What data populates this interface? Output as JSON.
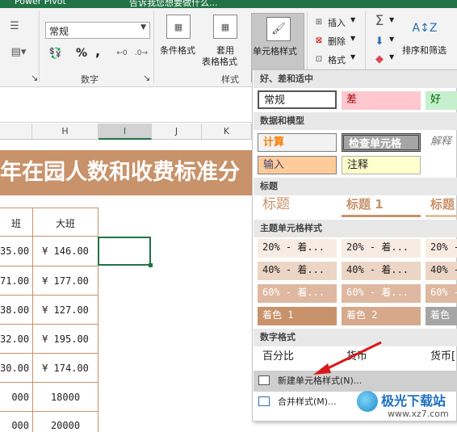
{
  "title_bar": {
    "left_text": "Power Pivot",
    "doc_text": "告诉我您想要做什么..."
  },
  "ribbon": {
    "number_format": "常规",
    "percent_symbol": "%",
    "comma_symbol": ",",
    "group_number_label": "数字",
    "cond_format_label": "条件格式",
    "table_format_label1": "套用",
    "table_format_label2": "表格格式",
    "cell_style_label": "单元格样式",
    "group_style_label": "样式",
    "insert_label": "插入",
    "delete_label": "删除",
    "format_label": "格式",
    "sort_filter_label": "排序和筛选"
  },
  "sheet": {
    "columns": [
      "H",
      "I",
      "J",
      "K"
    ],
    "banner_text": "年在园人数和收费标准分",
    "header_left": "班",
    "header_right": "大班",
    "rows": [
      {
        "left": "35.00",
        "right": "¥ 146.00"
      },
      {
        "left": "71.00",
        "right": "¥ 177.00"
      },
      {
        "left": "38.00",
        "right": "¥ 127.00"
      },
      {
        "left": "32.00",
        "right": "¥ 195.00"
      },
      {
        "left": "30.00",
        "right": "¥ 174.00"
      },
      {
        "left": "000",
        "right": "18000"
      },
      {
        "left": "000",
        "right": "20000"
      }
    ]
  },
  "dropdown": {
    "sec1": "好、差和适中",
    "normal": "常规",
    "bad": "差",
    "good": "好",
    "sec2": "数据和模型",
    "calc": "计算",
    "check": "检查单元格",
    "explain": "解释",
    "input": "输入",
    "note": "注释",
    "sec3": "标题",
    "title": "标题",
    "title1": "标题 1",
    "title2": "标题",
    "sec4": "主题单元格样式",
    "pct20": "20% - 着...",
    "pct40": "40% - 着...",
    "pct60": "60% - 着...",
    "accent1": "着色 1",
    "accent2": "着色 2",
    "accent3": "着色",
    "sec5": "数字格式",
    "percent": "百分比",
    "currency": "货币",
    "currency0": "货币[",
    "new_style": "新建单元格样式(N)...",
    "merge_style": "合并样式(M)..."
  },
  "watermark": {
    "text": "极光下载站",
    "url": "www.xz7.com"
  },
  "colors": {
    "accent": "#217346",
    "banner": "#c8926a",
    "bad_bg": "#ffc7ce",
    "good_bg": "#c6efce",
    "check_bg": "#a5a5a5",
    "input_bg": "#ffcc99",
    "note_bg": "#ffffcc"
  }
}
